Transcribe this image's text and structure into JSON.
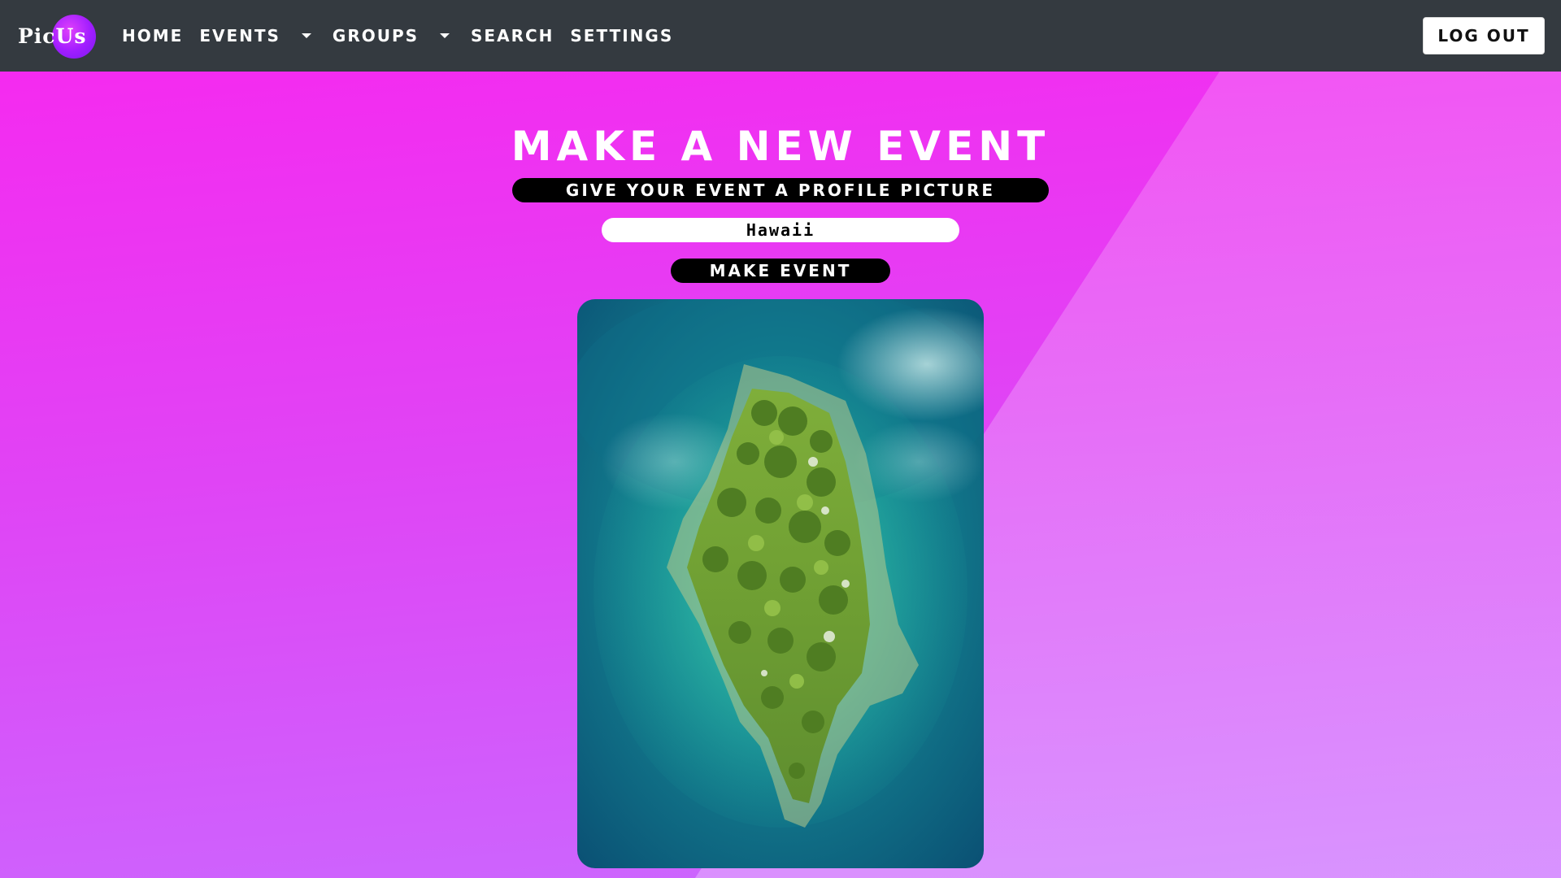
{
  "nav": {
    "brand": "PicUs",
    "items": [
      {
        "label": "Home"
      },
      {
        "label": "Events"
      },
      {
        "label": "Groups"
      },
      {
        "label": "Search"
      },
      {
        "label": "Settings"
      }
    ],
    "logout_label": "Log Out"
  },
  "main": {
    "title": "Make a New Event",
    "subtitle_button": "Give Your Event a Profile Picture",
    "event_name_value": "Hawaii",
    "submit_label": "Make Event"
  },
  "colors": {
    "navbar": "#343a40",
    "background_top": "#f52af0",
    "background_bottom": "#c96aff",
    "pill": "#000000"
  }
}
